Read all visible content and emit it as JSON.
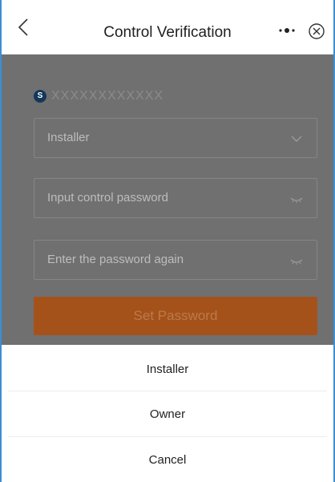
{
  "header": {
    "title": "Control Verification",
    "back_icon": "chevron-left-icon",
    "more_icon": "more-dots-icon",
    "close_icon": "close-circle-icon"
  },
  "device": {
    "serial": "XXXXXXXXXXXX",
    "serial_icon": "S"
  },
  "form": {
    "role_select_value": "Installer",
    "password_placeholder": "Input control password",
    "confirm_placeholder": "Enter the password again",
    "submit_label": "Set Password"
  },
  "action_sheet": {
    "items": [
      {
        "label": "Installer"
      },
      {
        "label": "Owner"
      }
    ],
    "cancel_label": "Cancel"
  },
  "colors": {
    "overlay": "#707070",
    "accent": "#a5521a",
    "frame_border": "#3b8fd6"
  }
}
